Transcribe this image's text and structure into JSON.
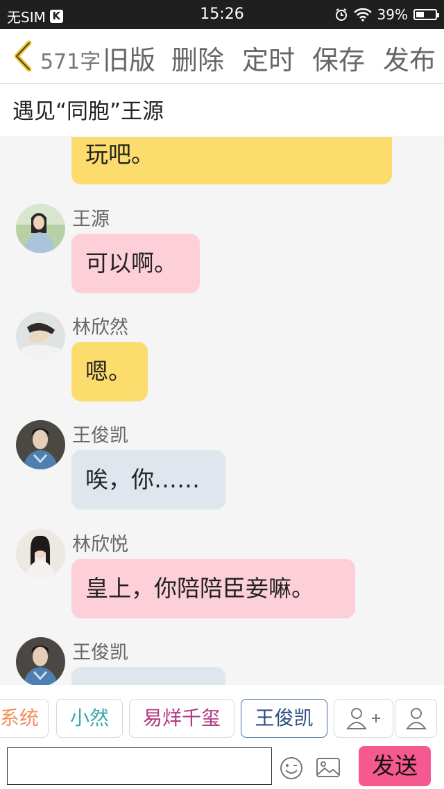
{
  "status_bar": {
    "carrier": "无SIM",
    "carrier_badge": "K",
    "time": "15:26",
    "battery": "39%"
  },
  "toolbar": {
    "word_count": "571字",
    "old_version": "旧版",
    "delete": "删除",
    "schedule": "定时",
    "save": "保存",
    "publish": "发布"
  },
  "story": {
    "title": "遇见“同胞”王源"
  },
  "messages": [
    {
      "name": "",
      "text": "玩吧。",
      "color": "#fddc6e"
    },
    {
      "name": "王源",
      "text": "可以啊。",
      "color": "#fccfd9"
    },
    {
      "name": "林欣然",
      "text": "嗯。",
      "color": "#fddc6e"
    },
    {
      "name": "王俊凯",
      "text": "唉，你……",
      "color": "#dfe6ee"
    },
    {
      "name": "林欣悦",
      "text": "皇上，你陪陪臣妾嘛。",
      "color": "#fccfd9"
    },
    {
      "name": "王俊凯",
      "text": "",
      "color": "#dfe6ee"
    }
  ],
  "character_chips": [
    {
      "label": "系统",
      "color": "#f0915a"
    },
    {
      "label": "小然",
      "color": "#3aa6a6"
    },
    {
      "label": "易烊千玺",
      "color": "#b2367f"
    },
    {
      "label": "王俊凯",
      "color": "#2d4f84",
      "selected": true
    }
  ],
  "icons": {
    "add_character": "person-add-icon",
    "manage_characters": "person-icon",
    "emoji": "emoji-icon",
    "image": "image-icon",
    "back": "chevron-left-icon"
  },
  "input": {
    "value": "",
    "placeholder": ""
  },
  "send_label": "发送"
}
